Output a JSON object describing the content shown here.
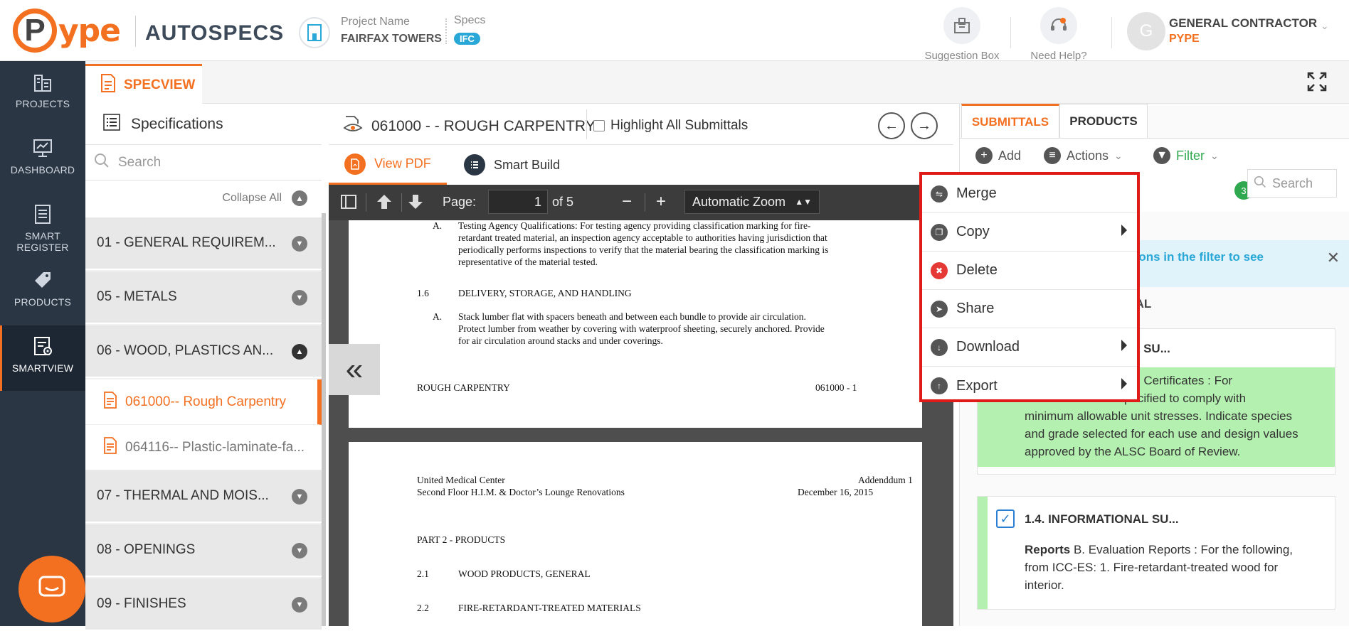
{
  "header": {
    "logo_text": "ype",
    "logo_letter": "P",
    "product": "AUTOSPECS",
    "project_label": "Project Name",
    "project_value": "FAIRFAX TOWERS",
    "specs_label": "Specs",
    "specs_badge": "IFC",
    "suggestion_box": "Suggestion Box",
    "need_help": "Need Help?",
    "avatar_letter": "G",
    "user_role": "GENERAL CONTRACTOR",
    "user_org": "PYPE"
  },
  "leftnav": {
    "items": [
      {
        "label": "PROJECTS",
        "icon": "building-icon"
      },
      {
        "label": "DASHBOARD",
        "icon": "monitor-icon"
      },
      {
        "label": "SMART REGISTER",
        "icon": "register-icon"
      },
      {
        "label": "PRODUCTS",
        "icon": "tag-icon"
      },
      {
        "label": "SMARTVIEW",
        "icon": "smartview-icon"
      }
    ]
  },
  "tabbar": {
    "specview": "SPECVIEW"
  },
  "specs": {
    "title": "Specifications",
    "search_placeholder": "Search",
    "collapse_all": "Collapse All",
    "divisions": [
      {
        "label": "01 - GENERAL REQUIREM..."
      },
      {
        "label": "05 - METALS"
      },
      {
        "label": "06 - WOOD, PLASTICS AN..."
      },
      {
        "label": "07 - THERMAL AND MOIS..."
      },
      {
        "label": "08 - OPENINGS"
      },
      {
        "label": "09 - FINISHES"
      }
    ],
    "sections": [
      {
        "label": "061000-- Rough Carpentry"
      },
      {
        "label": "064116-- Plastic-laminate-fa..."
      }
    ]
  },
  "center": {
    "doc_title": "061000 - - ROUGH CARPENTRY",
    "highlight_label": "Highlight All Submittals",
    "tab_view_pdf": "View PDF",
    "tab_smart_build": "Smart Build",
    "page_label": "Page:",
    "page_value": "1",
    "page_of": "of 5",
    "zoom_minus": "−",
    "zoom_plus": "+",
    "zoom_value": "Automatic Zoom"
  },
  "pdf": {
    "page1": {
      "a_label": "A.",
      "a_lines": [
        "Testing Agency Qualifications:  For testing agency providing classification marking for fire-",
        "retardant treated material, an inspection agency acceptable to authorities having jurisdiction that",
        "periodically performs inspections to verify that the material bearing the classification marking is",
        "representative of the material tested."
      ],
      "s16_num": "1.6",
      "s16_title": "DELIVERY, STORAGE, AND HANDLING",
      "b_label": "A.",
      "b_lines": [
        "Stack lumber flat with spacers beneath and between each bundle to provide air circulation.",
        "Protect lumber from weather by covering with waterproof sheeting, securely anchored.  Provide",
        "for air circulation around stacks and under coverings."
      ],
      "footer_left": "ROUGH CARPENTRY",
      "footer_right": "061000 - 1"
    },
    "page2": {
      "hdr_left_1": "United Medical Center",
      "hdr_left_2": "Second Floor H.I.M. & Doctor’s Lounge Renovations",
      "hdr_right_1": "Addenddum 1",
      "hdr_right_2": "December 16, 2015",
      "part2": "PART 2 - PRODUCTS",
      "s21_num": "2.1",
      "s21_title": "WOOD PRODUCTS, GENERAL",
      "s22_num": "2.2",
      "s22_title": "FIRE-RETARDANT-TREATED MATERIALS"
    }
  },
  "right": {
    "tab_submittals": "SUBMITTALS",
    "tab_products": "PRODUCTS",
    "add": "Add",
    "actions": "Actions",
    "filter": "Filter",
    "filter_count": "3",
    "search_placeholder": "Search",
    "info_text": "ll options in the filter to see",
    "section_title": "TIONAL",
    "card1_title": "AL SU...",
    "card1_lines": [
      "rial Certificates : For",
      "pecified to comply with",
      "minimum allowable unit stresses. Indicate species",
      "and grade selected for each use and design values",
      "approved by the ALSC Board of Review."
    ],
    "card2_title": "1.4. INFORMATIONAL SU...",
    "card2_bold": "Reports",
    "card2_lines": [
      " B. Evaluation Reports : For the following,",
      "from ICC-ES: 1. Fire-retardant-treated wood for",
      "interior."
    ]
  },
  "menu": {
    "items": [
      {
        "label": "Merge",
        "icon": "merge-icon",
        "has_sub": false
      },
      {
        "label": "Copy",
        "icon": "copy-icon",
        "has_sub": true
      },
      {
        "label": "Delete",
        "icon": "trash-icon",
        "has_sub": false
      },
      {
        "label": "Share",
        "icon": "share-icon",
        "has_sub": false
      },
      {
        "label": "Download",
        "icon": "download-icon",
        "has_sub": true
      },
      {
        "label": "Export",
        "icon": "export-icon",
        "has_sub": true
      }
    ]
  },
  "colors": {
    "brand_orange": "#f37021",
    "nav_bg": "#2b3645",
    "highlight_green": "#b4f0b0",
    "menu_border": "#e01919",
    "info_blue": "#29a7d6"
  }
}
